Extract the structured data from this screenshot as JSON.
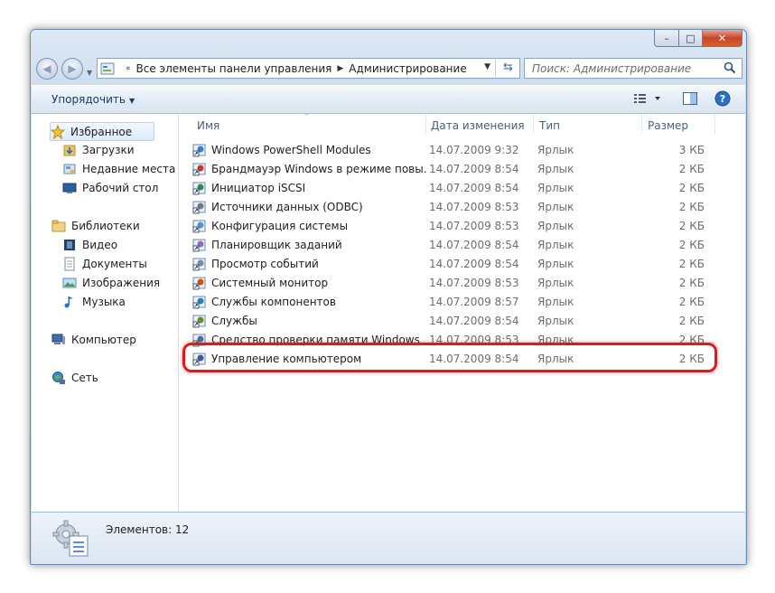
{
  "window": {
    "close_glyph": "✕",
    "max_glyph": "□",
    "min_glyph": "–"
  },
  "address": {
    "crumbs": [
      "Все элементы панели управления",
      "Администрирование"
    ],
    "search_placeholder": "Поиск: Администрирование"
  },
  "toolbar": {
    "organize_label": "Упорядочить"
  },
  "sidebar": {
    "favorites": {
      "label": "Избранное",
      "icon": "star-icon"
    },
    "favorites_items": [
      {
        "label": "Загрузки",
        "icon": "downloads-folder-icon"
      },
      {
        "label": "Недавние места",
        "icon": "recent-places-icon"
      },
      {
        "label": "Рабочий стол",
        "icon": "desktop-icon"
      }
    ],
    "libraries": {
      "label": "Библиотеки",
      "icon": "libraries-icon"
    },
    "libraries_items": [
      {
        "label": "Видео",
        "icon": "video-icon"
      },
      {
        "label": "Документы",
        "icon": "documents-icon"
      },
      {
        "label": "Изображения",
        "icon": "pictures-icon"
      },
      {
        "label": "Музыка",
        "icon": "music-icon"
      }
    ],
    "computer": {
      "label": "Компьютер",
      "icon": "computer-icon"
    },
    "network": {
      "label": "Сеть",
      "icon": "network-icon"
    }
  },
  "columns": {
    "name": "Имя",
    "date": "Дата изменения",
    "type": "Тип",
    "size": "Размер"
  },
  "files": [
    {
      "name": "Windows PowerShell Modules",
      "date": "14.07.2009 9:32",
      "type": "Ярлык",
      "size": "3 КБ"
    },
    {
      "name": "Брандмауэр Windows в режиме повы...",
      "date": "14.07.2009 8:54",
      "type": "Ярлык",
      "size": "2 КБ"
    },
    {
      "name": "Инициатор iSCSI",
      "date": "14.07.2009 8:54",
      "type": "Ярлык",
      "size": "2 КБ"
    },
    {
      "name": "Источники данных (ODBC)",
      "date": "14.07.2009 8:53",
      "type": "Ярлык",
      "size": "2 КБ"
    },
    {
      "name": "Конфигурация системы",
      "date": "14.07.2009 8:53",
      "type": "Ярлык",
      "size": "2 КБ"
    },
    {
      "name": "Планировщик заданий",
      "date": "14.07.2009 8:54",
      "type": "Ярлык",
      "size": "2 КБ"
    },
    {
      "name": "Просмотр событий",
      "date": "14.07.2009 8:54",
      "type": "Ярлык",
      "size": "2 КБ"
    },
    {
      "name": "Системный монитор",
      "date": "14.07.2009 8:53",
      "type": "Ярлык",
      "size": "2 КБ"
    },
    {
      "name": "Службы компонентов",
      "date": "14.07.2009 8:57",
      "type": "Ярлык",
      "size": "2 КБ"
    },
    {
      "name": "Службы",
      "date": "14.07.2009 8:54",
      "type": "Ярлык",
      "size": "2 КБ"
    },
    {
      "name": "Средство проверки памяти Windows",
      "date": "14.07.2009 8:53",
      "type": "Ярлык",
      "size": "2 КБ"
    },
    {
      "name": "Управление компьютером",
      "date": "14.07.2009 8:54",
      "type": "Ярлык",
      "size": "2 КБ"
    }
  ],
  "status": {
    "count_text": "Элементов: 12"
  },
  "colors": {
    "highlight": "#e01a1a",
    "link_text": "#1e3c68"
  }
}
